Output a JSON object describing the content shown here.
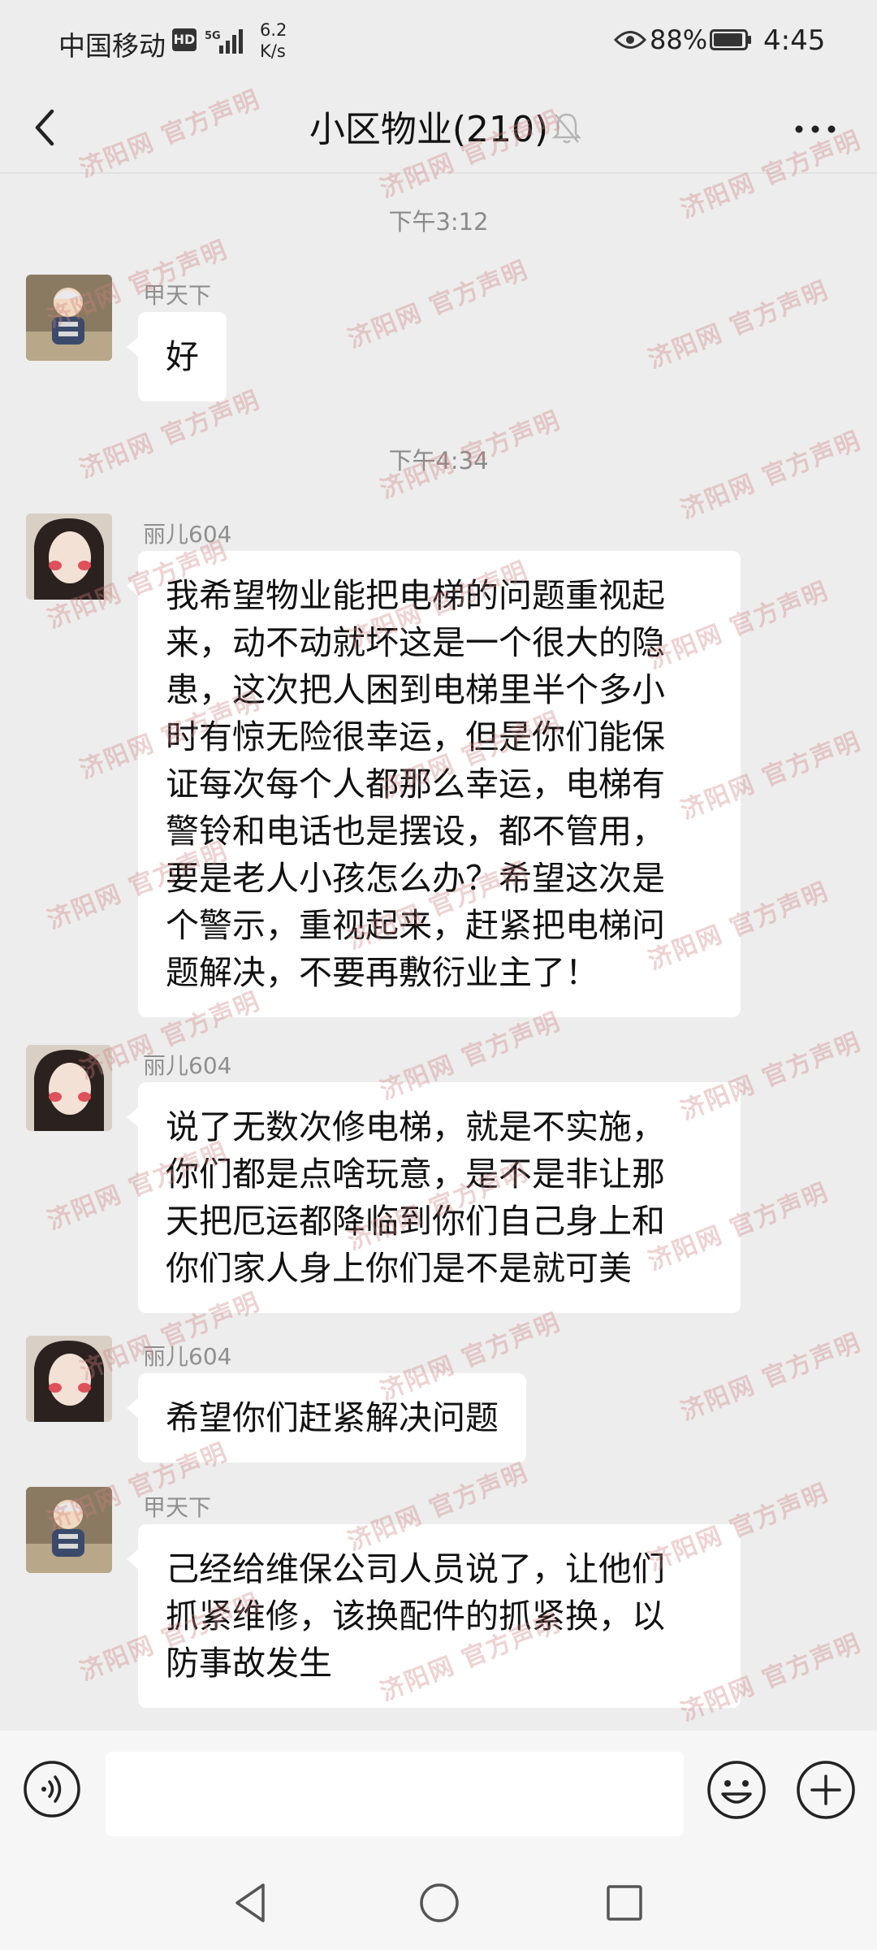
{
  "status_bar": {
    "carrier": "中国移动",
    "hd_badge": "HD",
    "speed_value": "6.2",
    "speed_unit": "K/s",
    "battery_pct": "88%",
    "time": "4:45"
  },
  "header": {
    "title": "小区物业(210)",
    "back_icon": "chevron-left-icon",
    "mute_icon": "bell-off-icon",
    "more_icon": "more-dots-icon"
  },
  "timestamps": [
    "下午3:12",
    "下午4:34"
  ],
  "messages": [
    {
      "sender": "甲天下",
      "text": "好"
    },
    {
      "sender": "丽儿604",
      "text": "我希望物业能把电梯的问题重视起\n来，动不动就坏这是一个很大的隐\n患，这次把人困到电梯里半个多小\n时有惊无险很幸运，但是你们能保\n证每次每个人都那么幸运，电梯有\n警铃和电话也是摆设，都不管用，\n要是老人小孩怎么办？希望这次是\n个警示，重视起来，赶紧把电梯问\n题解决，不要再敷衍业主了！"
    },
    {
      "sender": "丽儿604",
      "text": "说了无数次修电梯，就是不实施，\n你们都是点啥玩意，是不是非让那\n天把厄运都降临到你们自己身上和\n你们家人身上你们是不是就可美"
    },
    {
      "sender": "丽儿604",
      "text": "希望你们赶紧解决问题"
    },
    {
      "sender": "甲天下",
      "text": "己经给维保公司人员说了，让他们\n抓紧维修，该换配件的抓紧换，以\n防事故发生"
    }
  ],
  "input": {
    "value": "",
    "placeholder": ""
  },
  "watermark": {
    "text": "济阳网 官方声明"
  },
  "colors": {
    "background": "#ededed",
    "bubble": "#ffffff",
    "bar": "#f6f6f6",
    "muted_text": "#8f8f8f"
  }
}
